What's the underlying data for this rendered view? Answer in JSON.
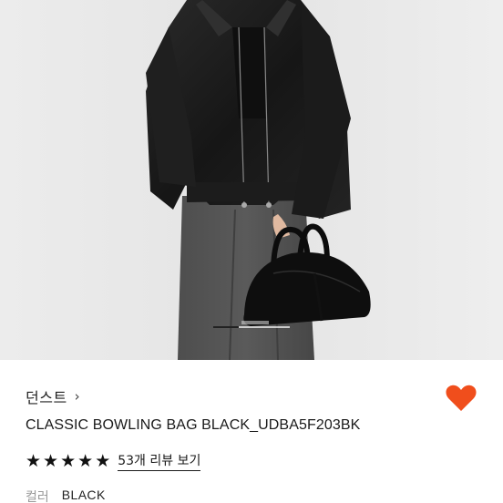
{
  "product": {
    "brand": "던스트",
    "brand_chevron": "›",
    "title": "CLASSIC BOWLING BAG BLACK_UDBA5F203BK",
    "rating": {
      "stars": [
        "★",
        "★",
        "★",
        "★",
        "★"
      ],
      "value": 5,
      "review_link": "53개 리뷰 보기"
    },
    "option": {
      "label": "컬러",
      "value": "BLACK"
    },
    "wishlist_color": "#f04e1c"
  },
  "gallery": {
    "current_index": 1
  }
}
